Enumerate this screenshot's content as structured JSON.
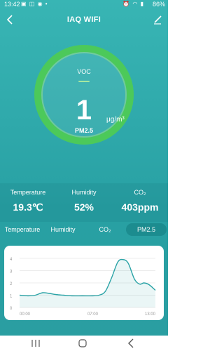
{
  "status_bar": {
    "time": "13:42",
    "battery": "86%"
  },
  "header": {
    "title": "IAQ WIFI"
  },
  "gauge": {
    "top_label": "VOC",
    "value": "1",
    "sub_label": "PM2.5",
    "unit": "μg/m³",
    "ring_fill": 1.0
  },
  "stats": [
    {
      "label": "Temperature",
      "value": "19.3℃"
    },
    {
      "label": "Humidity",
      "value": "52%"
    },
    {
      "label": "CO₂",
      "value": "403ppm"
    }
  ],
  "tabs": [
    {
      "label": "Temperature"
    },
    {
      "label": "Humidity"
    },
    {
      "label": "CO₂"
    },
    {
      "label": "PM2.5",
      "active": true
    }
  ],
  "chart_data": {
    "type": "area",
    "x_ticks": [
      "00:00",
      "07:00",
      "13:00"
    ],
    "y_ticks": [
      "0",
      "1",
      "2",
      "3",
      "4"
    ],
    "ylim": [
      0,
      4
    ],
    "xlim": [
      0,
      13
    ],
    "grid": true,
    "series": [
      {
        "x": [
          0,
          0.8,
          1.5,
          2.2,
          2.8,
          3.5,
          4.2,
          5,
          6,
          7,
          7.6,
          8.2,
          8.8,
          9.4,
          9.9,
          10.4,
          11,
          11.5,
          11.9,
          12.4,
          13
        ],
        "values": [
          1.0,
          0.95,
          1.0,
          1.2,
          1.15,
          1.05,
          1.0,
          0.95,
          0.95,
          0.95,
          1.0,
          1.3,
          2.4,
          3.7,
          3.9,
          3.6,
          2.3,
          1.9,
          2.0,
          1.85,
          1.4
        ]
      }
    ]
  }
}
